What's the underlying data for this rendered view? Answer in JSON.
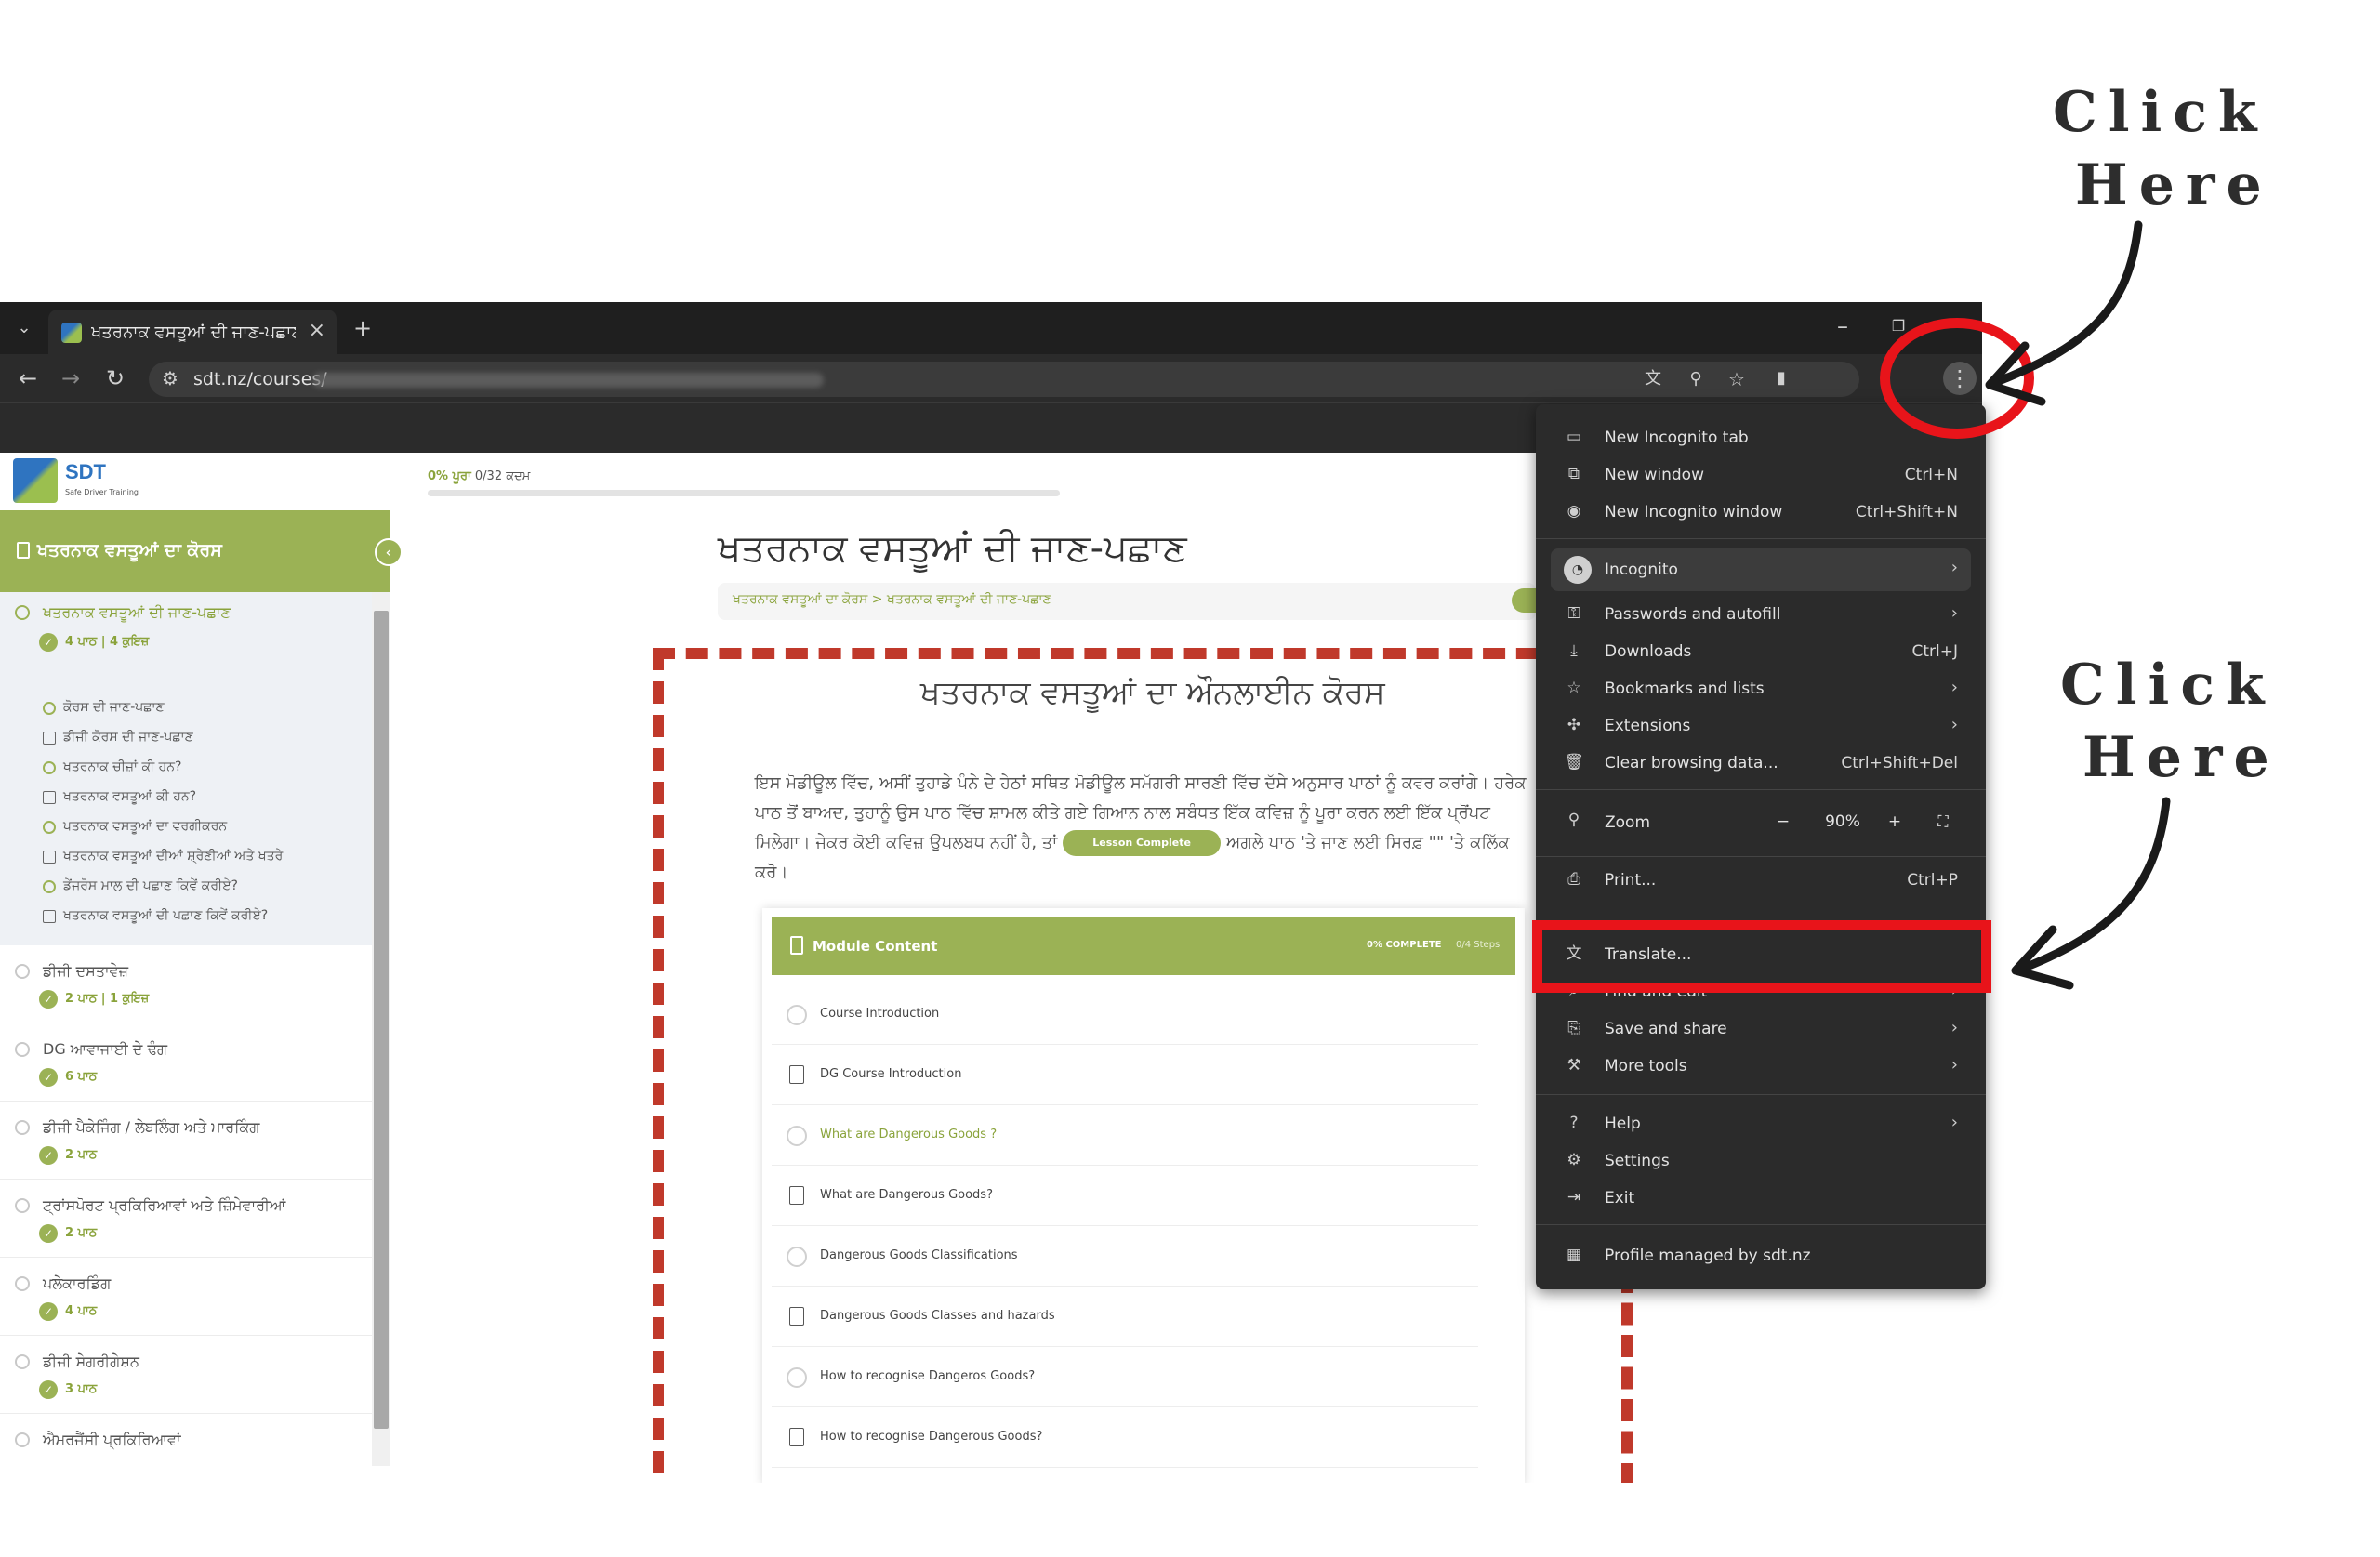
{
  "annotations": {
    "top": "Click\nHere",
    "bottom": "Click\nHere"
  },
  "tab": {
    "title": "ਖਤਰਨਾਕ ਵਸਤੂਆਂ ਦੀ ਜਾਣ-ਪਛਾਣ | S"
  },
  "address": {
    "url": "sdt.nz/courses/"
  },
  "logo": {
    "text": "SDT",
    "sub": "Safe Driver Training"
  },
  "progress": {
    "pct": "0% ਪੂਰਾ",
    "steps": "0/32 ਕਦਮ",
    "fraction": 0
  },
  "sidebar": {
    "course_title": "ਖਤਰਨਾਕ ਵਸਤੂਆਂ ਦਾ ਕੋਰਸ",
    "lessons": [
      {
        "name": "ਖਤਰਨਾਕ ਵਸਤੂਆਂ ਦੀ ਜਾਣ-ਪਛਾਣ",
        "meta": "4 ਪਾਠ  |  4 ਕੁਇਜ਼"
      },
      {
        "name": "ਡੀਜੀ ਦਸਤਾਵੇਜ਼",
        "meta": "2 ਪਾਠ  |  1 ਕੁਇਜ਼"
      },
      {
        "name": "DG ਆਵਾਜਾਈ ਦੇ ਢੰਗ",
        "meta": "6 ਪਾਠ"
      },
      {
        "name": "ਡੀਜੀ ਪੈਕੇਜਿੰਗ / ਲੇਬਲਿੰਗ ਅਤੇ ਮਾਰਕਿੰਗ",
        "meta": "2 ਪਾਠ"
      },
      {
        "name": "ਟ੍ਰਾਂਸਪੋਰਟ ਪ੍ਰਕਿਰਿਆਵਾਂ ਅਤੇ ਜ਼ਿੰਮੇਵਾਰੀਆਂ",
        "meta": "2 ਪਾਠ"
      },
      {
        "name": "ਪਲੇਕਾਰਡਿੰਗ",
        "meta": "4 ਪਾਠ"
      },
      {
        "name": "ਡੀਜੀ ਸੇਗਰੀਗੇਸ਼ਨ",
        "meta": "3 ਪਾਠ"
      },
      {
        "name": "ਐਮਰਜੈਂਸੀ ਪ੍ਰਕਿਰਿਆਵਾਂ",
        "meta": ""
      }
    ],
    "sub_items": [
      "ਕੋਰਸ ਦੀ ਜਾਣ-ਪਛਾਣ",
      "ਡੀਜੀ ਕੋਰਸ ਦੀ ਜਾਣ-ਪਛਾਣ",
      "ਖਤਰਨਾਕ ਚੀਜ਼ਾਂ ਕੀ ਹਨ?",
      "ਖਤਰਨਾਕ ਵਸਤੂਆਂ ਕੀ ਹਨ?",
      "ਖਤਰਨਾਕ ਵਸਤੂਆਂ ਦਾ ਵਰਗੀਕਰਨ",
      "ਖਤਰਨਾਕ ਵਸਤੂਆਂ ਦੀਆਂ ਸ਼੍ਰੇਣੀਆਂ ਅਤੇ ਖਤਰੇ",
      "ਡੇਂਜਰੋਸ ਮਾਲ ਦੀ ਪਛਾਣ ਕਿਵੇਂ ਕਰੀਏ?",
      "ਖਤਰਨਾਕ ਵਸਤੂਆਂ ਦੀ ਪਛਾਣ ਕਿਵੇਂ ਕਰੀਏ?"
    ]
  },
  "main": {
    "title": "ਖਤਰਨਾਕ ਵਸਤੂਆਂ ਦੀ ਜਾਣ-ਪਛਾਣ",
    "breadcrumb": "ਖਤਰਨਾਕ ਵਸਤੂਆਂ ਦਾ ਕੋਰਸ > ਖਤਰਨਾਕ ਵਸਤੂਆਂ ਦੀ ਜਾਣ-ਪਛਾਣ",
    "content_title": "ਖਤਰਨਾਕ ਵਸਤੂਆਂ ਦਾ ਔਨਲਾਈਨ ਕੋਰਸ",
    "paragraph_a": "ਇਸ ਮੋਡੀਊਲ ਵਿੱਚ, ਅਸੀਂ ਤੁਹਾਡੇ ਪੰਨੇ ਦੇ ਹੇਠਾਂ ਸਥਿਤ ਮੋਡੀਊਲ ਸਮੱਗਰੀ ਸਾਰਣੀ ਵਿੱਚ ਦੱਸੇ ਅਨੁਸਾਰ ਪਾਠਾਂ ਨੂੰ ਕਵਰ ਕਰਾਂਗੇ। ਹਰੇਕ ਪਾਠ ਤੋਂ ਬਾਅਦ, ਤੁਹਾਨੂੰ ਉਸ ਪਾਠ ਵਿੱਚ ਸ਼ਾਮਲ ਕੀਤੇ ਗਏ ਗਿਆਨ ਨਾਲ ਸਬੰਧਤ ਇੱਕ ਕਵਿਜ਼ ਨੂੰ ਪੂਰਾ ਕਰਨ ਲਈ ਇੱਕ ਪ੍ਰੋਂਪਟ ਮਿਲੇਗਾ। ਜੇਕਰ ਕੋਈ ਕਵਿਜ਼ ਉਪਲਬਧ ਨਹੀਂ ਹੈ, ਤਾਂ",
    "lesson_complete": "Lesson Complete",
    "paragraph_b": "ਅਗਲੇ ਪਾਠ 'ਤੇ ਜਾਣ ਲਈ ਸਿਰਫ਼ \"\" 'ਤੇ ਕਲਿੱਕ ਕਰੋ।"
  },
  "module": {
    "title": "Module Content",
    "pct": "0% COMPLETE",
    "steps": "0/4 Steps",
    "rows": [
      {
        "label": "Course Introduction",
        "kind": "circle",
        "active": false
      },
      {
        "label": "DG Course Introduction",
        "kind": "doc",
        "active": false
      },
      {
        "label": "What are Dangerous Goods ?",
        "kind": "circle",
        "active": true
      },
      {
        "label": "What are Dangerous Goods?",
        "kind": "doc",
        "active": false
      },
      {
        "label": "Dangerous Goods Classifications",
        "kind": "circle",
        "active": false
      },
      {
        "label": "Dangerous Goods Classes and hazards",
        "kind": "doc",
        "active": false
      },
      {
        "label": "How to recognise Dangeros Goods?",
        "kind": "circle",
        "active": false
      },
      {
        "label": "How to recognise Dangerous Goods?",
        "kind": "doc",
        "active": false
      }
    ]
  },
  "menu": {
    "new_incognito_tab": "New Incognito tab",
    "new_window": "New window",
    "new_window_sc": "Ctrl+N",
    "new_incognito_window": "New Incognito window",
    "new_incognito_window_sc": "Ctrl+Shift+N",
    "incognito": "Incognito",
    "passwords": "Passwords and autofill",
    "downloads": "Downloads",
    "downloads_sc": "Ctrl+J",
    "bookmarks": "Bookmarks and lists",
    "extensions": "Extensions",
    "clear": "Clear browsing data...",
    "clear_sc": "Ctrl+Shift+Del",
    "zoom": "Zoom",
    "zoom_value": "90%",
    "zoom_minus": "−",
    "zoom_plus": "+",
    "print": "Print...",
    "print_sc": "Ctrl+P",
    "translate": "Translate...",
    "find": "Find and edit",
    "save_share": "Save and share",
    "more_tools": "More tools",
    "help": "Help",
    "settings": "Settings",
    "exit": "Exit",
    "managed": "Profile managed by sdt.nz"
  },
  "colors": {
    "accent_green": "#9bb255",
    "annotation_red": "#e8141a",
    "chrome_dark": "#2b2b2b"
  }
}
